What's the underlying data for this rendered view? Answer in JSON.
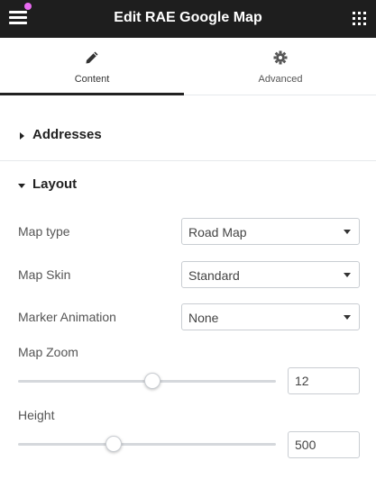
{
  "header": {
    "title": "Edit RAE Google Map",
    "menu_icon": "hamburger-icon",
    "apps_icon": "grid-icon",
    "notification_color": "#e86af0"
  },
  "tabs": [
    {
      "label": "Content",
      "icon": "pencil-icon",
      "active": true
    },
    {
      "label": "Advanced",
      "icon": "gear-icon",
      "active": false
    }
  ],
  "sections": {
    "addresses": {
      "title": "Addresses",
      "expanded": false
    },
    "layout": {
      "title": "Layout",
      "expanded": true
    }
  },
  "layout": {
    "map_type": {
      "label": "Map type",
      "value": "Road Map"
    },
    "map_skin": {
      "label": "Map Skin",
      "value": "Standard"
    },
    "marker_animation": {
      "label": "Marker Animation",
      "value": "None"
    },
    "map_zoom": {
      "label": "Map Zoom",
      "value": "12",
      "slider_fraction": 0.52
    },
    "height": {
      "label": "Height",
      "value": "500",
      "slider_fraction": 0.37
    }
  }
}
